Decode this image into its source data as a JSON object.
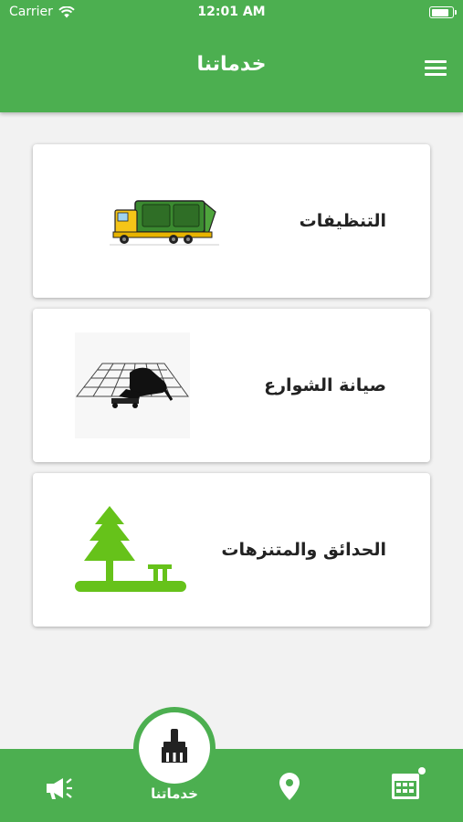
{
  "status_bar": {
    "carrier": "Carrier",
    "time": "12:01 AM",
    "battery_level": 0.9
  },
  "header": {
    "title": "خدماتنا",
    "menu_icon": "hamburger-menu-icon"
  },
  "services": [
    {
      "label": "التنظيفات",
      "icon": "garbage-truck-image"
    },
    {
      "label": "صيانة الشوارع",
      "icon": "street-repair-image"
    },
    {
      "label": "الحدائق والمتنزهات",
      "icon": "tree-park-image"
    }
  ],
  "bottom_nav": {
    "center_label": "خدماتنا",
    "items": [
      "megaphone-icon",
      "broom-icon",
      "location-pin-icon",
      "calendar-icon"
    ]
  },
  "colors": {
    "primary": "#4caf50",
    "tree": "#66c21a",
    "background": "#f2f2f2"
  }
}
